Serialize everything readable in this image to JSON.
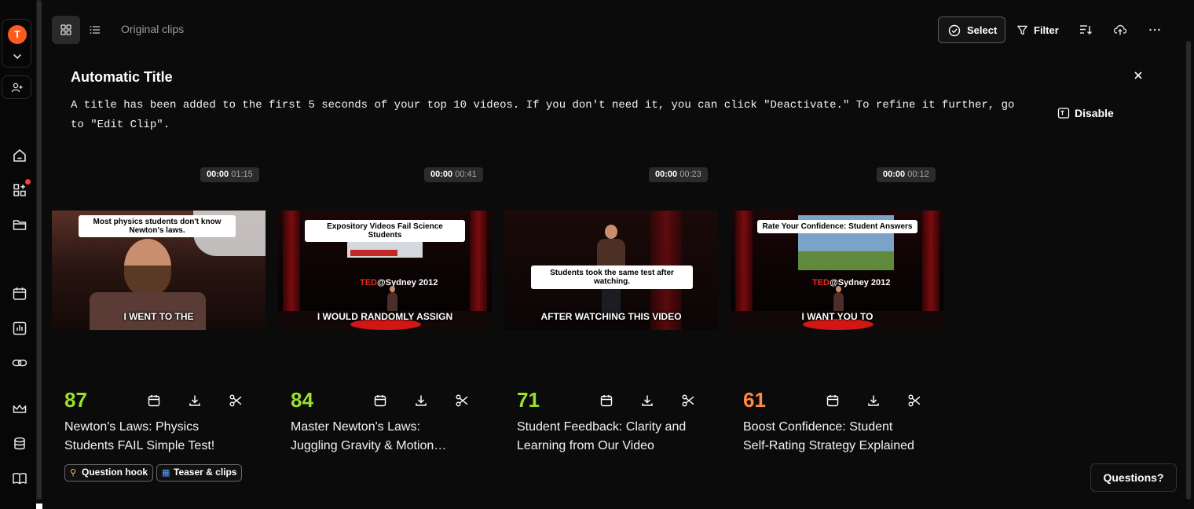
{
  "rail": {
    "avatar_letter": "T",
    "avatar_color": "#ff5a1f",
    "notification_color": "#ff3b3b",
    "icons": [
      "home-icon",
      "apps-add-icon",
      "folder-icon",
      "calendar-icon",
      "analytics-icon",
      "link-icon",
      "crown-icon",
      "database-icon",
      "book-icon"
    ]
  },
  "toolbar": {
    "breadcrumb": "Original clips",
    "select_label": "Select",
    "filter_label": "Filter"
  },
  "banner": {
    "title": "Automatic Title",
    "text": "A title has been added to the first 5 seconds of your top 10 videos. If you don't need it, you can click \"Deactivate.\" To refine it further, go to \"Edit Clip\".",
    "disable_label": "Disable"
  },
  "colors": {
    "score_green": "#9be02b",
    "score_orange": "#ff8a3d"
  },
  "clips": [
    {
      "time_start": "00:00",
      "duration": "01:15",
      "overlay_title": "Most physics students don't know Newton's laws.",
      "caption": "I WENT TO THE",
      "score": "87",
      "score_color": "#9be02b",
      "title_line1": "Newton's Laws: Physics",
      "title_line2": "Students FAIL Simple Test!",
      "tags": [
        {
          "icon": "hook-icon",
          "label": "Question hook"
        },
        {
          "icon": "film-icon",
          "label": "Teaser & clips"
        }
      ]
    },
    {
      "time_start": "00:00",
      "duration": "00:41",
      "overlay_title": "Expository Videos Fail Science Students",
      "caption": "I WOULD RANDOMLY ASSIGN",
      "event_brand": "TED",
      "event_suffix": "@Sydney 2012",
      "score": "84",
      "score_color": "#9be02b",
      "title_line1": "Master Newton's Laws:",
      "title_line2": "Juggling Gravity & Motion…"
    },
    {
      "time_start": "00:00",
      "duration": "00:23",
      "overlay_title": "Students took the same test after watching.",
      "caption": "AFTER WATCHING THIS VIDEO",
      "score": "71",
      "score_color": "#9be02b",
      "title_line1": "Student Feedback: Clarity and",
      "title_line2": "Learning from Our Video"
    },
    {
      "time_start": "00:00",
      "duration": "00:12",
      "overlay_title": "Rate Your Confidence: Student Answers",
      "caption": "I WANT YOU TO",
      "event_brand": "TED",
      "event_suffix": "@Sydney 2012",
      "score": "61",
      "score_color": "#ff8a3d",
      "title_line1": "Boost Confidence: Student",
      "title_line2": "Self-Rating Strategy Explained"
    }
  ],
  "help": {
    "questions_label": "Questions?"
  }
}
